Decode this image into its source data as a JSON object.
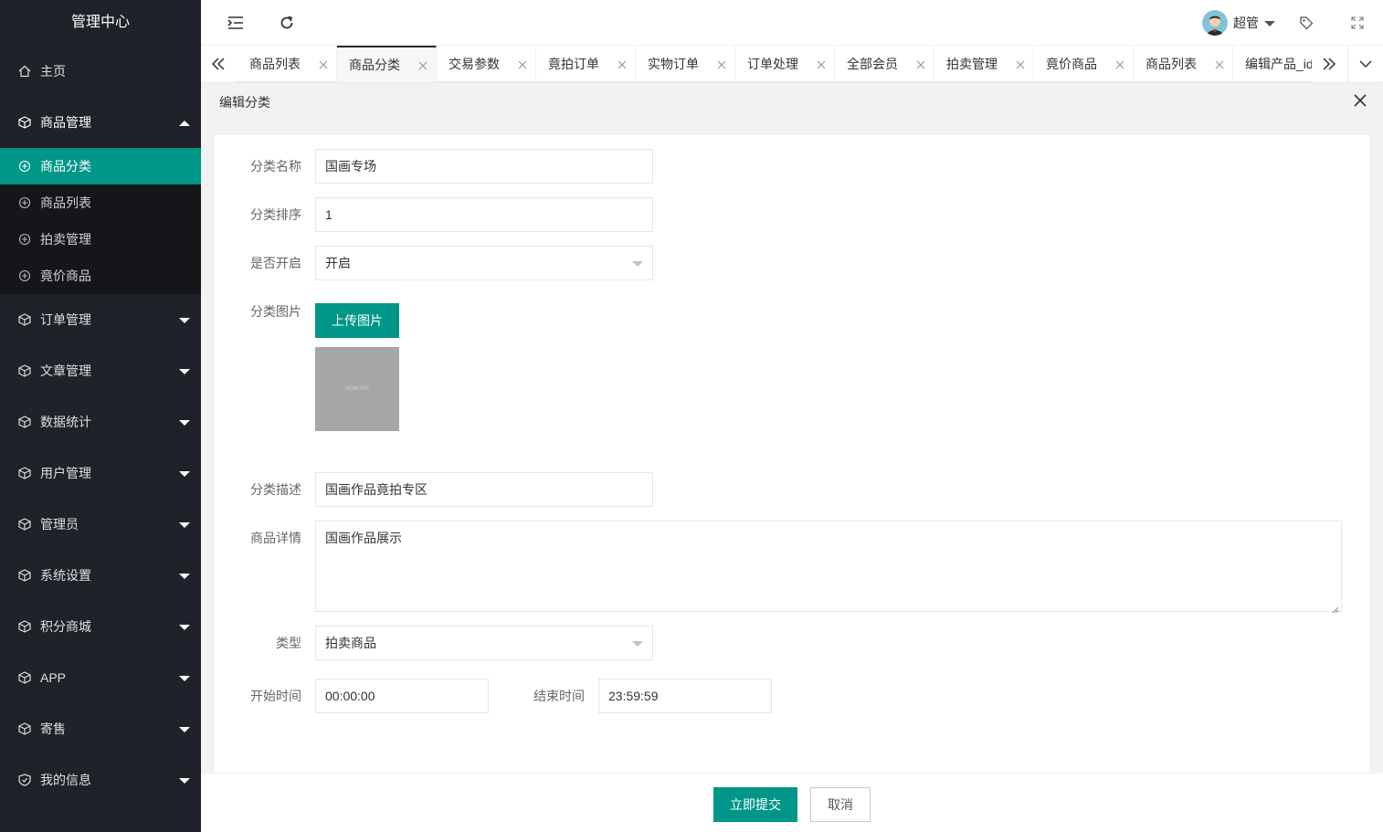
{
  "app": {
    "title": "管理中心"
  },
  "sidebar": {
    "home": "主页",
    "goods": {
      "label": "商品管理",
      "children": [
        "商品分类",
        "商品列表",
        "拍卖管理",
        "竟价商品"
      ]
    },
    "items": [
      "订单管理",
      "文章管理",
      "数据统计",
      "用户管理",
      "管理员",
      "系统设置",
      "积分商城",
      "APP",
      "寄售",
      "我的信息"
    ]
  },
  "header": {
    "user_name": "超管"
  },
  "tabs": [
    "商品列表",
    "商品分类",
    "交易参数",
    "竟拍订单",
    "实物订单",
    "订单处理",
    "全部会员",
    "拍卖管理",
    "竟价商品",
    "商品列表",
    "编辑产品_id"
  ],
  "edit": {
    "title": "编辑分类",
    "name_label": "分类名称",
    "name_value": "国画专场",
    "sort_label": "分类排序",
    "sort_value": "1",
    "open_label": "是否开启",
    "open_value": "开启",
    "image_label": "分类图片",
    "upload_label": "上传图片",
    "thumb_text": "NOW PIC",
    "desc_label": "分类描述",
    "desc_value": "国画作品竟拍专区",
    "detail_label": "商品详情",
    "detail_value": "国画作品展示",
    "type_label": "类型",
    "type_value": "拍卖商品",
    "start_label": "开始时间",
    "start_value": "00:00:00",
    "end_label": "结束时间",
    "end_value": "23:59:59"
  },
  "footer": {
    "submit": "立即提交",
    "cancel": "取消"
  },
  "colors": {
    "accent": "#009688",
    "sidebar_bg": "#20222a",
    "subnav_bg": "#15161a"
  }
}
